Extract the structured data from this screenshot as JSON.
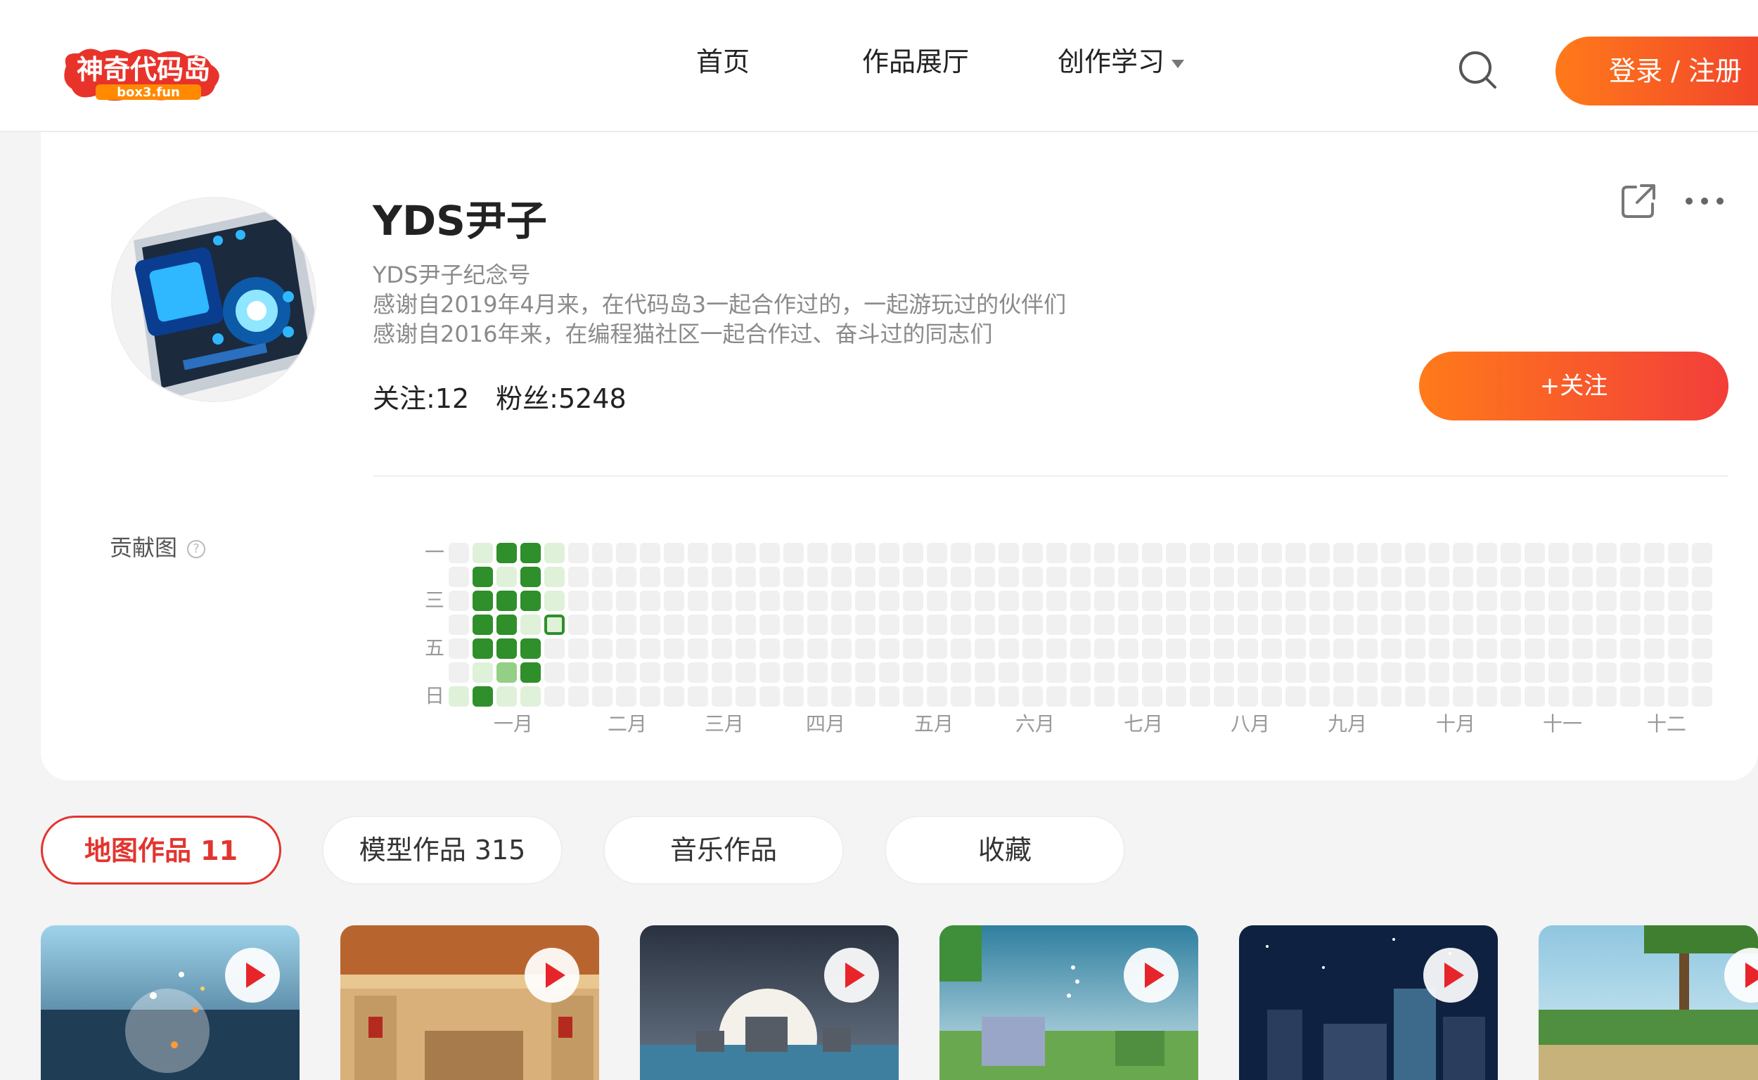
{
  "header": {
    "logo_text": "神奇代码岛",
    "logo_sub": "box3.fun",
    "nav": [
      {
        "label": "首页"
      },
      {
        "label": "作品展厅"
      },
      {
        "label": "创作学习"
      }
    ],
    "login_label": "登录 / 注册"
  },
  "profile": {
    "username": "YDS尹子",
    "bio": [
      "YDS尹子纪念号",
      "感谢自2019年4月来，在代码岛3一起合作过的，一起游玩过的伙伴们",
      "感谢自2016年来，在编程猫社区一起合作过、奋斗过的同志们"
    ],
    "following_label": "关注:12",
    "followers_label": "粉丝:5248",
    "follow_button": "+关注"
  },
  "contribution": {
    "label": "贡献图",
    "day_labels": [
      "一",
      "三",
      "五",
      "日"
    ],
    "months": [
      "一月",
      "二月",
      "三月",
      "四月",
      "五月",
      "六月",
      "七月",
      "八月",
      "九月",
      "十月",
      "十一",
      "十二"
    ],
    "active_cells": [
      {
        "col": 1,
        "row": 0,
        "level": 1
      },
      {
        "col": 2,
        "row": 0,
        "level": 4
      },
      {
        "col": 3,
        "row": 0,
        "level": 4
      },
      {
        "col": 4,
        "row": 0,
        "level": 1
      },
      {
        "col": 1,
        "row": 1,
        "level": 4
      },
      {
        "col": 2,
        "row": 1,
        "level": 1
      },
      {
        "col": 3,
        "row": 1,
        "level": 4
      },
      {
        "col": 4,
        "row": 1,
        "level": 1
      },
      {
        "col": 1,
        "row": 2,
        "level": 4
      },
      {
        "col": 2,
        "row": 2,
        "level": 4
      },
      {
        "col": 3,
        "row": 2,
        "level": 4
      },
      {
        "col": 4,
        "row": 2,
        "level": 1
      },
      {
        "col": 1,
        "row": 3,
        "level": 4
      },
      {
        "col": 2,
        "row": 3,
        "level": 4
      },
      {
        "col": 3,
        "row": 3,
        "level": 1
      },
      {
        "col": 4,
        "row": 3,
        "level": 0,
        "today": true
      },
      {
        "col": 1,
        "row": 4,
        "level": 4
      },
      {
        "col": 2,
        "row": 4,
        "level": 4
      },
      {
        "col": 3,
        "row": 4,
        "level": 4
      },
      {
        "col": 1,
        "row": 5,
        "level": 1
      },
      {
        "col": 2,
        "row": 5,
        "level": 2
      },
      {
        "col": 3,
        "row": 5,
        "level": 4
      },
      {
        "col": 0,
        "row": 6,
        "level": 1
      },
      {
        "col": 1,
        "row": 6,
        "level": 4
      },
      {
        "col": 2,
        "row": 6,
        "level": 1
      },
      {
        "col": 3,
        "row": 6,
        "level": 1
      }
    ]
  },
  "tabs": [
    {
      "label": "地图作品 11",
      "active": true
    },
    {
      "label": "模型作品 315",
      "active": false
    },
    {
      "label": "音乐作品",
      "active": false
    },
    {
      "label": "收藏",
      "active": false
    }
  ],
  "colors": {
    "accent": "#f2462b",
    "green_dark": "#2f8f2a",
    "green_mid": "#93cf85",
    "green_light": "#dff1d9",
    "empty": "#f0f0f0"
  }
}
